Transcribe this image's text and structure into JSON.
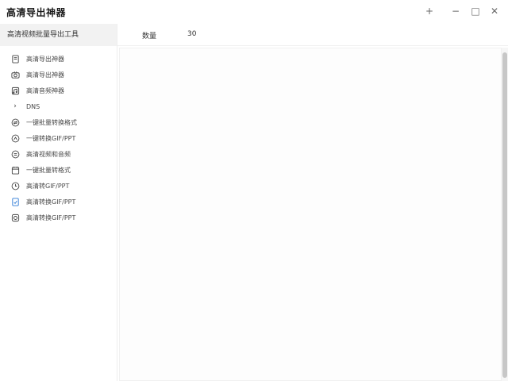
{
  "window": {
    "title": "高清导出神器",
    "controls": {
      "pin": "+",
      "minimize": "−",
      "maximize": "□",
      "close": "✕"
    }
  },
  "sidebar": {
    "header": "高清视频批量导出工具",
    "items": [
      {
        "label": "高清导出神器",
        "icon": "document-icon"
      },
      {
        "label": "高清导出神器",
        "icon": "camera-icon"
      },
      {
        "label": "高清音频神器",
        "icon": "audio-icon"
      },
      {
        "label": "DNS",
        "icon": "chevron-right-icon"
      },
      {
        "label": "一键批量转换格式",
        "icon": "convert-icon"
      },
      {
        "label": "一键转换GIF/PPT",
        "icon": "gif-icon"
      },
      {
        "label": "高清视频和音频",
        "icon": "media-icon"
      },
      {
        "label": "一键批量转格式",
        "icon": "calendar-icon"
      },
      {
        "label": "高清转GIF/PPT",
        "icon": "clock-icon"
      },
      {
        "label": "高清转换GIF/PPT",
        "icon": "file-icon"
      },
      {
        "label": "高清转换GIF/PPT",
        "icon": "image-icon"
      }
    ]
  },
  "topbar": {
    "label": "数量",
    "value": "30"
  }
}
